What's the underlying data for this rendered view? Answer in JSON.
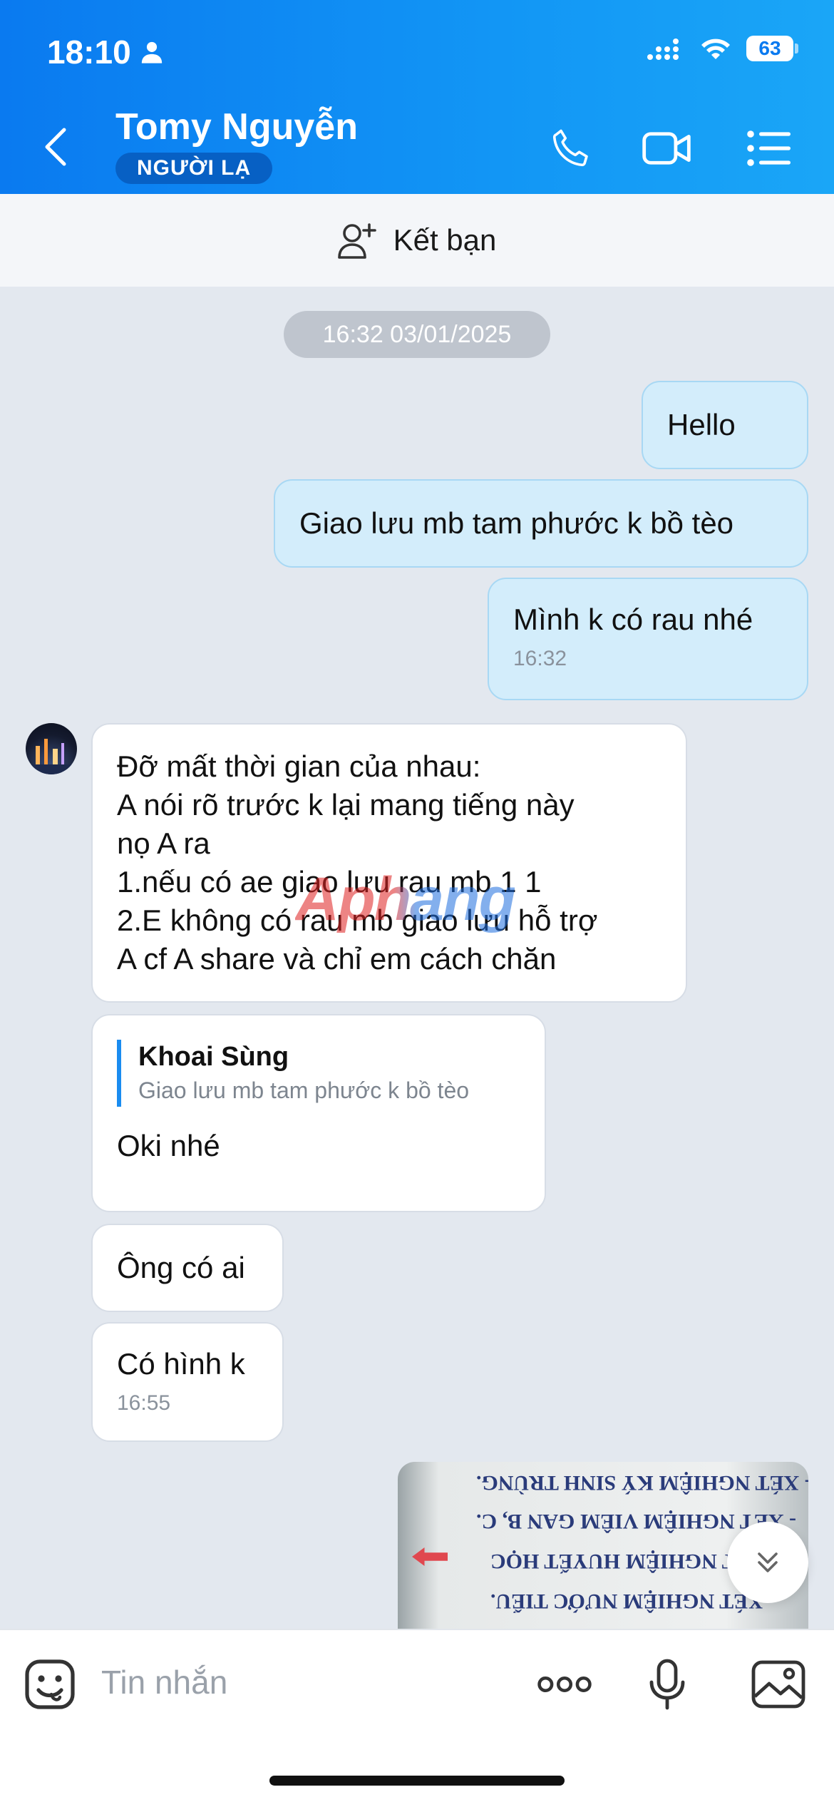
{
  "status_bar": {
    "time": "18:10",
    "battery": "63"
  },
  "header": {
    "contact_name": "Tomy Nguyễn",
    "badge": "NGƯỜI LẠ"
  },
  "add_friend": {
    "label": "Kết bạn"
  },
  "date_separator": "16:32 03/01/2025",
  "messages": [
    {
      "direction": "out",
      "text": "Hello"
    },
    {
      "direction": "out",
      "text": "Giao lưu mb tam phước k bồ tèo"
    },
    {
      "direction": "out",
      "text": "Mình k có rau nhé",
      "time": "16:32"
    },
    {
      "direction": "in",
      "text": "Đỡ mất thời gian của nhau:\nA nói rõ trước k lại mang tiếng này\nnọ A ra\n1.nếu có ae giao lưu rau mb 1 1\n2.E không có rau mb giao lưu hỗ trợ\nA cf A share và chỉ em cách chăn"
    },
    {
      "direction": "in",
      "reply_to": {
        "name": "Khoai Sùng",
        "text": "Giao lưu mb tam phước k bồ tèo"
      },
      "text": "Oki nhé"
    },
    {
      "direction": "in",
      "text": "Ông có ai"
    },
    {
      "direction": "in",
      "text": "Có hình k",
      "time": "16:55"
    }
  ],
  "photo": {
    "lines": [
      "- XÉT NGHIỆM NƯỚC TIỂU.",
      "- XÉT NGHIỆM HUYẾT HỌC",
      "- XÉT NGHIỆM VIÊM GAN B, C.",
      "- XÉT NGHIỆM KÝ SINH TRÙNG."
    ]
  },
  "composer": {
    "placeholder": "Tin nhắn"
  },
  "watermark": "Aphang",
  "colors": {
    "header": "#0a7af0",
    "outgoing_bubble": "#d3edfb",
    "incoming_bubble": "#ffffff",
    "chat_bg": "#e3e8ef"
  }
}
